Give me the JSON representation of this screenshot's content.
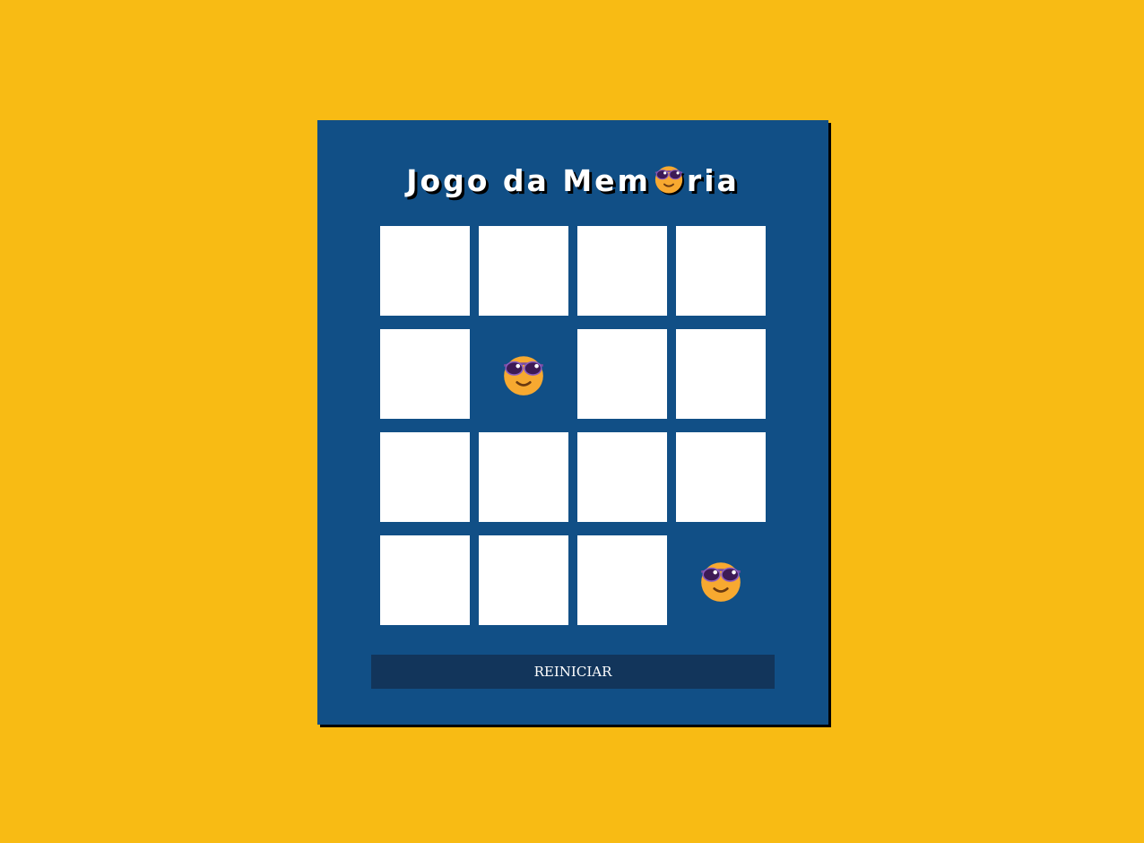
{
  "game": {
    "title_before": "Jogo da Mem",
    "title_emoji": "cool-face-icon",
    "title_after": "ria",
    "restart_label": "REINICIAR",
    "colors": {
      "background": "#f8bb14",
      "panel": "#114f86",
      "button": "#12355b",
      "card_back": "#ffffff",
      "emoji_face": "#f7a930",
      "emoji_glasses": "#3d1a55"
    },
    "columns": 4,
    "rows": 4,
    "cards": [
      {
        "state": "hidden"
      },
      {
        "state": "hidden"
      },
      {
        "state": "hidden"
      },
      {
        "state": "hidden"
      },
      {
        "state": "hidden"
      },
      {
        "state": "revealed",
        "icon": "cool-face-icon"
      },
      {
        "state": "hidden"
      },
      {
        "state": "hidden"
      },
      {
        "state": "hidden"
      },
      {
        "state": "hidden"
      },
      {
        "state": "hidden"
      },
      {
        "state": "hidden"
      },
      {
        "state": "hidden"
      },
      {
        "state": "hidden"
      },
      {
        "state": "hidden"
      },
      {
        "state": "revealed",
        "icon": "cool-face-icon"
      }
    ]
  }
}
